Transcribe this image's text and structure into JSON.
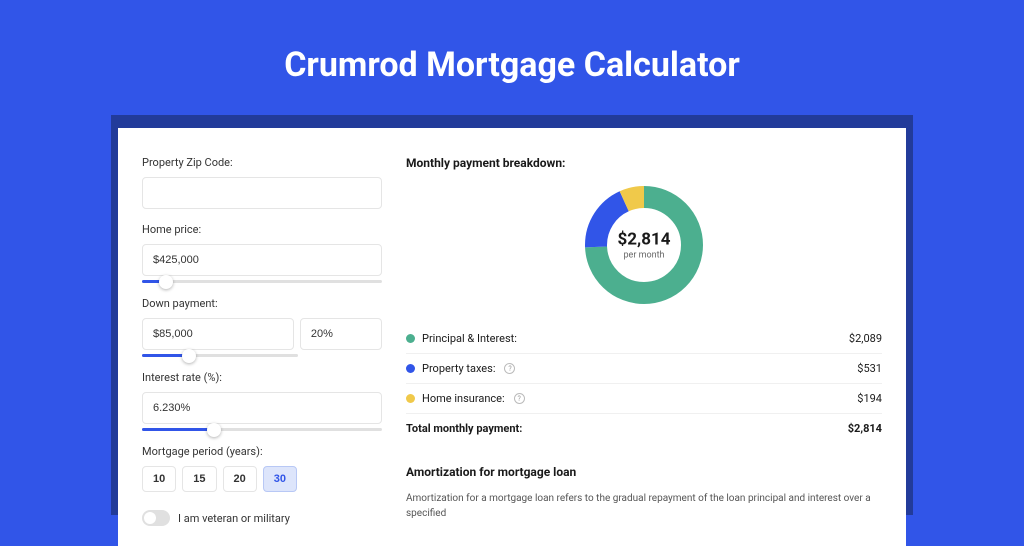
{
  "title": "Crumrod Mortgage Calculator",
  "form": {
    "zip_label": "Property Zip Code:",
    "zip_value": "",
    "home_price_label": "Home price:",
    "home_price_value": "$425,000",
    "down_payment_label": "Down payment:",
    "down_payment_value": "$85,000",
    "down_payment_pct": "20%",
    "interest_label": "Interest rate (%):",
    "interest_value": "6.230%",
    "period_label": "Mortgage period (years):",
    "periods": [
      "10",
      "15",
      "20",
      "30"
    ],
    "period_selected": "30",
    "veteran_label": "I am veteran or military"
  },
  "breakdown": {
    "title": "Monthly payment breakdown:",
    "donut_amount": "$2,814",
    "donut_sub": "per month",
    "items": [
      {
        "label": "Principal & Interest:",
        "value": "$2,089",
        "color": "#4caf8f",
        "help": false
      },
      {
        "label": "Property taxes:",
        "value": "$531",
        "color": "#3155e8",
        "help": true
      },
      {
        "label": "Home insurance:",
        "value": "$194",
        "color": "#f0c94a",
        "help": true
      }
    ],
    "total_label": "Total monthly payment:",
    "total_value": "$2,814"
  },
  "amortization": {
    "title": "Amortization for mortgage loan",
    "text": "Amortization for a mortgage loan refers to the gradual repayment of the loan principal and interest over a specified"
  },
  "chart_data": {
    "type": "pie",
    "title": "Monthly payment breakdown",
    "series": [
      {
        "name": "Principal & Interest",
        "value": 2089,
        "color": "#4caf8f"
      },
      {
        "name": "Property taxes",
        "value": 531,
        "color": "#3155e8"
      },
      {
        "name": "Home insurance",
        "value": 194,
        "color": "#f0c94a"
      }
    ],
    "total": 2814
  },
  "colors": {
    "primary": "#3155e8",
    "green": "#4caf8f",
    "yellow": "#f0c94a"
  }
}
